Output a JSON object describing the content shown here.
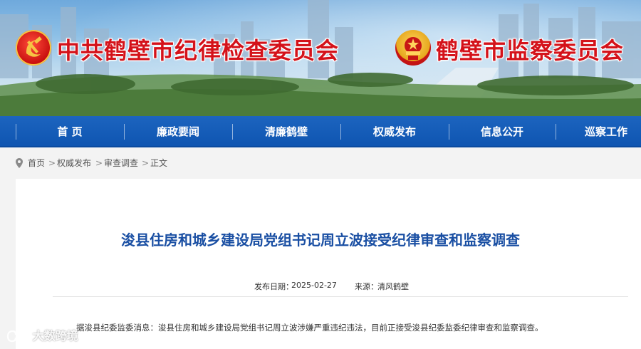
{
  "header": {
    "left_title": "中共鹤壁市纪律检查委员会",
    "right_title": "鹤壁市监察委员会"
  },
  "nav": {
    "items": [
      {
        "label": "首  页"
      },
      {
        "label": "廉政要闻"
      },
      {
        "label": "清廉鹤壁"
      },
      {
        "label": "权威发布"
      },
      {
        "label": "信息公开"
      },
      {
        "label": "巡察工作"
      }
    ]
  },
  "breadcrumb": {
    "items": [
      {
        "label": "首页"
      },
      {
        "label": "权威发布"
      },
      {
        "label": "审查调查"
      },
      {
        "label": "正文"
      }
    ],
    "separator": ">"
  },
  "article": {
    "title": "浚县住房和城乡建设局党组书记周立波接受纪律审查和监察调查",
    "publish_label": "发布日期：",
    "publish_date": "2025-02-27",
    "source_label": "来源：",
    "source": "清风鹤壁",
    "body": "据浚县纪委监委消息：浚县住房和城乡建设局党组书记周立波涉嫌严重违纪违法，目前正接受浚县纪委监委纪律审查和监察调查。"
  },
  "watermark": {
    "text": "大数跨境"
  },
  "colors": {
    "nav_blue": "#0f55b1",
    "title_red": "#d4121a",
    "article_title_blue": "#1a4fa3"
  }
}
